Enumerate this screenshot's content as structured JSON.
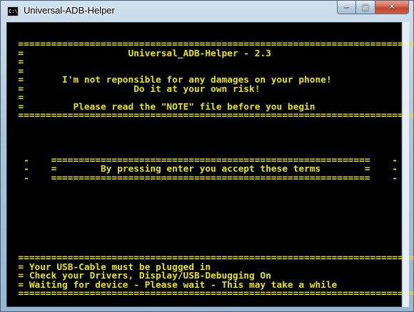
{
  "window": {
    "title": "Universal-ADB-Helper",
    "icon_text": "C:\\.",
    "controls": {
      "minimize": "−",
      "maximize": "□",
      "close": "✕"
    }
  },
  "console": {
    "lines": [
      "",
      "",
      "  ===========================================================================",
      "  =                   Universal_ADB-Helper - 2.3                            =",
      "  =                                                                         =",
      "  =                                                                         =",
      "  =       I'm not reponsible for any damages on your phone!                 =",
      "  =                    Do it at your own risk!                              =",
      "  =                                                                         =",
      "  =         Please read the \"NOTE\" file before you begin                    =",
      "  ===========================================================================",
      "",
      "",
      "",
      "",
      "   -    ==========================================================    -",
      "   -    =        By pressing enter you accept these terms        =    -",
      "   -    ==========================================================    -",
      "",
      "",
      "",
      "",
      "",
      "",
      "",
      "",
      "  ===========================================================================",
      "  = Your USB-Cable must be plugged in                                       =",
      "  = Check your Drivers, Display/USB-Debugging On                            =",
      "  = Waiting for device - Please wait - This may take a while                =",
      "  ==========================================================================="
    ]
  }
}
